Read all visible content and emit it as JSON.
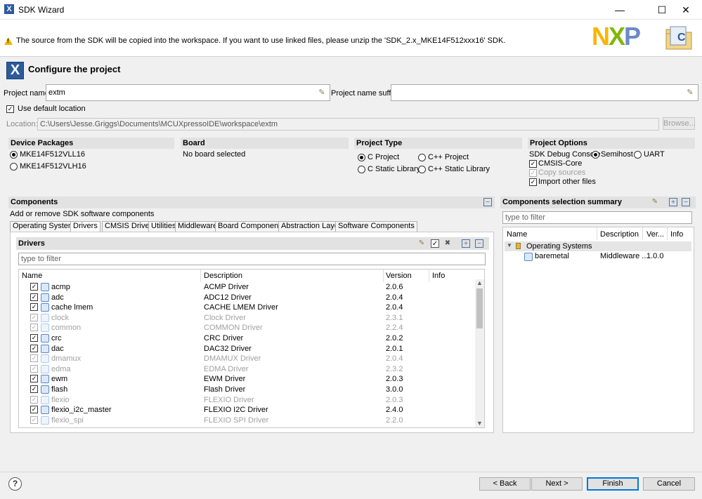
{
  "window": {
    "title": "SDK Wizard"
  },
  "banner": {
    "message": "The source from the SDK will be copied into the workspace. If you want to use linked files, please unzip the 'SDK_2.x_MKE14F512xxx16' SDK.",
    "logo": "NXP"
  },
  "page": {
    "title": "Configure the project"
  },
  "project": {
    "name_label": "Project name:",
    "name_value": "extm",
    "suffix_label": "Project name suffix:",
    "suffix_value": "",
    "default_location_label": "Use default location",
    "location_label": "Location:",
    "location_value": "C:\\Users\\Jesse.Griggs\\Documents\\MCUXpressoIDE\\workspace\\extm",
    "browse_label": "Browse..."
  },
  "device_packages": {
    "header": "Device Packages",
    "items": [
      "MKE14F512VLL16",
      "MKE14F512VLH16"
    ],
    "selected": "MKE14F512VLL16"
  },
  "board": {
    "header": "Board",
    "value": "No board selected"
  },
  "project_type": {
    "header": "Project Type",
    "options": [
      "C Project",
      "C++ Project",
      "C Static Library",
      "C++ Static Library"
    ],
    "selected": "C Project"
  },
  "project_options": {
    "header": "Project Options",
    "debug_console_label": "SDK Debug Console",
    "semihost": "Semihost",
    "uart": "UART",
    "cmsis_core": "CMSIS-Core",
    "copy_sources": "Copy sources",
    "import_other": "Import other files"
  },
  "components": {
    "header": "Components",
    "subtitle": "Add or remove SDK software components",
    "tabs": [
      "Operating Systems",
      "Drivers",
      "CMSIS Drivers",
      "Utilities",
      "Middleware",
      "Board Components",
      "Abstraction Layer",
      "Software Components"
    ],
    "active_tab": "Drivers",
    "drivers_header": "Drivers",
    "filter_placeholder": "type to filter",
    "columns": [
      "Name",
      "Description",
      "Version",
      "Info"
    ],
    "rows": [
      {
        "name": "acmp",
        "desc": "ACMP Driver",
        "ver": "2.0.6",
        "enabled": true
      },
      {
        "name": "adc",
        "desc": "ADC12 Driver",
        "ver": "2.0.4",
        "enabled": true
      },
      {
        "name": "cache lmem",
        "desc": "CACHE LMEM Driver",
        "ver": "2.0.4",
        "enabled": true
      },
      {
        "name": "clock",
        "desc": "Clock Driver",
        "ver": "2.3.1",
        "enabled": false
      },
      {
        "name": "common",
        "desc": "COMMON Driver",
        "ver": "2.2.4",
        "enabled": false
      },
      {
        "name": "crc",
        "desc": "CRC Driver",
        "ver": "2.0.2",
        "enabled": true
      },
      {
        "name": "dac",
        "desc": "DAC32 Driver",
        "ver": "2.0.1",
        "enabled": true
      },
      {
        "name": "dmamux",
        "desc": "DMAMUX Driver",
        "ver": "2.0.4",
        "enabled": false
      },
      {
        "name": "edma",
        "desc": "EDMA Driver",
        "ver": "2.3.2",
        "enabled": false
      },
      {
        "name": "ewm",
        "desc": "EWM Driver",
        "ver": "2.0.3",
        "enabled": true
      },
      {
        "name": "flash",
        "desc": "Flash Driver",
        "ver": "3.0.0",
        "enabled": true
      },
      {
        "name": "flexio",
        "desc": "FLEXIO Driver",
        "ver": "2.0.3",
        "enabled": false
      },
      {
        "name": "flexio_i2c_master",
        "desc": "FLEXIO I2C Driver",
        "ver": "2.4.0",
        "enabled": true
      },
      {
        "name": "flexio_spi",
        "desc": "FLEXIO SPI Driver",
        "ver": "2.2.0",
        "enabled": false
      }
    ]
  },
  "summary": {
    "header": "Components selection summary",
    "filter_placeholder": "type to filter",
    "columns": [
      "Name",
      "Description",
      "Ver...",
      "Info"
    ],
    "group": "Operating Systems",
    "item": {
      "name": "baremetal",
      "desc": "Middleware ...",
      "ver": "1.0.0"
    }
  },
  "buttons": {
    "back": "< Back",
    "next": "Next >",
    "finish": "Finish",
    "cancel": "Cancel",
    "help": "?"
  }
}
